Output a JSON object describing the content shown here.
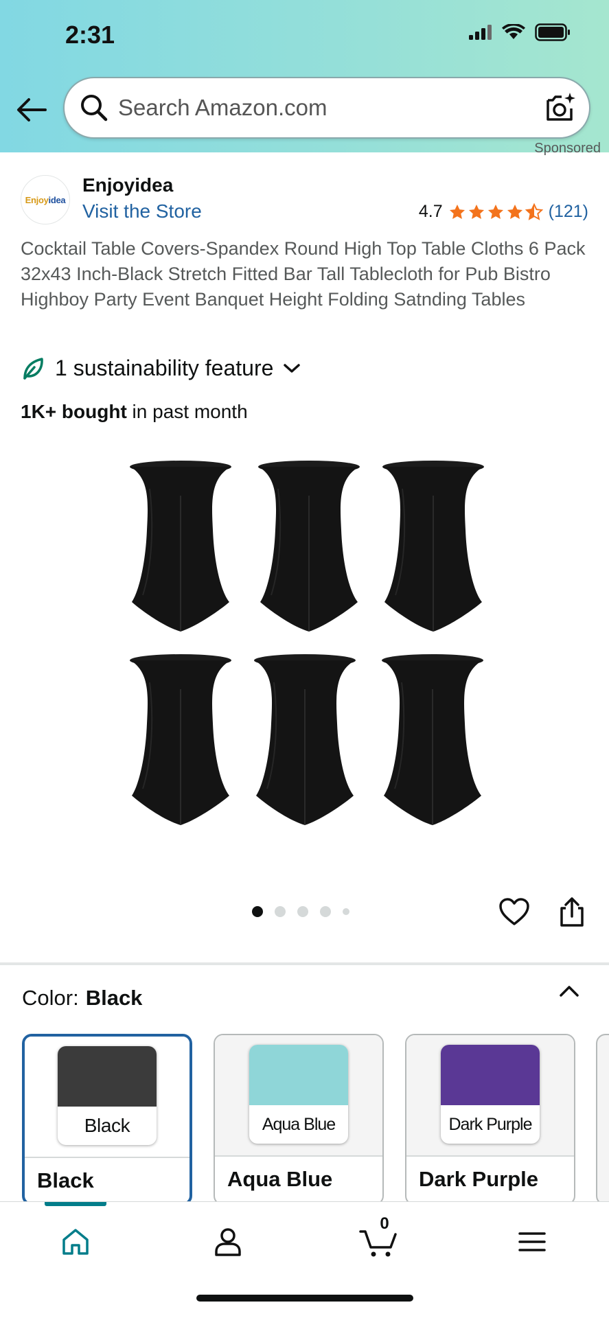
{
  "status_bar": {
    "time": "2:31"
  },
  "search": {
    "placeholder": "Search Amazon.com"
  },
  "sponsored_label": "Sponsored",
  "store": {
    "logo_text_a": "Enjoy",
    "logo_text_b": "idea",
    "brand": "Enjoyidea",
    "visit_link": "Visit the Store"
  },
  "rating": {
    "value": "4.7",
    "stars": 4.7,
    "count": "(121)"
  },
  "product": {
    "title": "Cocktail Table Covers-Spandex Round High Top Table Cloths 6 Pack 32x43 Inch-Black Stretch Fitted Bar Tall Tablecloth for Pub Bistro Highboy Party Event Banquet Height Folding Satnding Tables",
    "sustainability": "1 sustainability feature",
    "bought_bold": "1K+ bought",
    "bought_rest": " in past month"
  },
  "gallery": {
    "image_count": 5,
    "active_index": 0
  },
  "color": {
    "label": "Color:",
    "selected": "Black",
    "options": [
      {
        "chip_label": "Black",
        "name": "Black",
        "hex": "#3b3b3b"
      },
      {
        "chip_label": "Aqua Blue",
        "name": "Aqua Blue",
        "hex": "#8fd6d8"
      },
      {
        "chip_label": "Dark Purple",
        "name": "Dark Purple",
        "hex": "#5a3895"
      }
    ]
  },
  "bottom_nav": {
    "cart_count": "0"
  },
  "colors": {
    "accent_teal": "#027d8a",
    "link_blue": "#2162a1",
    "star_orange": "#f3731c",
    "selected_border": "#2162a1"
  }
}
